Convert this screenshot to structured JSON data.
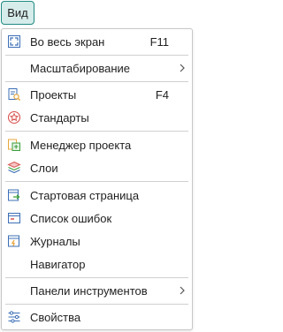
{
  "menubar": {
    "view_label": "Вид"
  },
  "menu": {
    "fullscreen": {
      "label": "Во весь экран",
      "shortcut": "F11",
      "icon": "fullscreen-icon"
    },
    "zoom": {
      "label": "Масштабирование",
      "icon": "chevron-right-icon"
    },
    "projects": {
      "label": "Проекты",
      "shortcut": "F4",
      "icon": "projects-icon"
    },
    "standards": {
      "label": "Стандарты",
      "icon": "standards-icon"
    },
    "project_manager": {
      "label": "Менеджер проекта",
      "icon": "project-manager-icon"
    },
    "layers": {
      "label": "Слои",
      "icon": "layers-icon"
    },
    "start_page": {
      "label": "Стартовая страница",
      "icon": "start-page-icon"
    },
    "error_list": {
      "label": "Список ошибок",
      "icon": "error-list-icon"
    },
    "logs": {
      "label": "Журналы",
      "icon": "logs-icon"
    },
    "navigator": {
      "label": "Навигатор"
    },
    "toolbars": {
      "label": "Панели инструментов",
      "icon": "chevron-right-icon"
    },
    "properties": {
      "label": "Свойства",
      "icon": "properties-icon"
    }
  },
  "colors": {
    "accent": "#1f8a82",
    "active_bg": "#d6ecea",
    "icon_blue": "#3b6fb6",
    "icon_red": "#d9534f",
    "icon_green": "#3a9d3a",
    "icon_orange": "#e8a63a",
    "separator": "#d0d0d0"
  }
}
